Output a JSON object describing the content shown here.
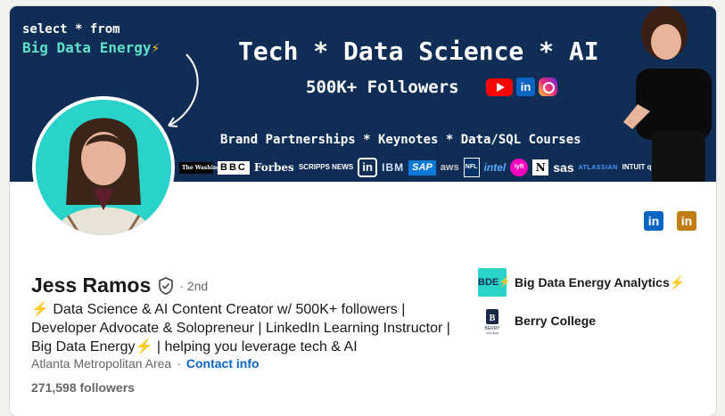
{
  "banner": {
    "tagline_top": "select * from",
    "tagline_brand": "Big Data Energy",
    "tagline_bolt": "⚡",
    "headline": "Tech * Data Science * AI",
    "followers_line": "500K+ Followers",
    "services_line": "Brand Partnerships * Keynotes * Data/SQL Courses",
    "social_badges": [
      "youtube-icon",
      "linkedin-icon",
      "instagram-icon"
    ],
    "linkedin_badge_text": "in",
    "partner_logos": {
      "washington_post": "The Washington Post",
      "bbc": "BBC",
      "forbes": "Forbes",
      "scripps": "SCRIPPS NEWS",
      "linkedin": "in",
      "ibm": "IBM",
      "sap": "SAP",
      "aws": "aws",
      "nfl": "NFL",
      "intel": "intel",
      "lyft": "lyft",
      "notion": "N",
      "sas": "sas",
      "atlassian": "ATLASSIAN",
      "quickbooks": "INTUIT quickbooks"
    }
  },
  "profile": {
    "name": "Jess Ramos",
    "degree": "· 2nd",
    "headline_bolt": "⚡",
    "headline_text": " Data Science & AI Content Creator w/ 500K+ followers | Developer Advocate & Solopreneur | LinkedIn Learning Instructor | Big Data Energy",
    "headline_tail": " | helping you leverage tech & AI",
    "location": "Atlanta Metropolitan Area",
    "contact_link": "Contact info",
    "followers": "271,598 followers"
  },
  "social_links": [
    {
      "name": "linkedin-icon",
      "label": "in"
    },
    {
      "name": "linkedin-icon",
      "label": "in"
    }
  ],
  "organizations": [
    {
      "name": "Big Data Energy Analytics",
      "bolt": "⚡",
      "logo_text": "BDE⚡"
    },
    {
      "name": "Berry College",
      "logo_text": "BERRY COLLEGE"
    }
  ],
  "colors": {
    "banner_bg": "#0f2d55",
    "brand_teal": "#2ad3c9",
    "link_blue": "#0a66c2",
    "gold_icon": "#c37d16"
  }
}
